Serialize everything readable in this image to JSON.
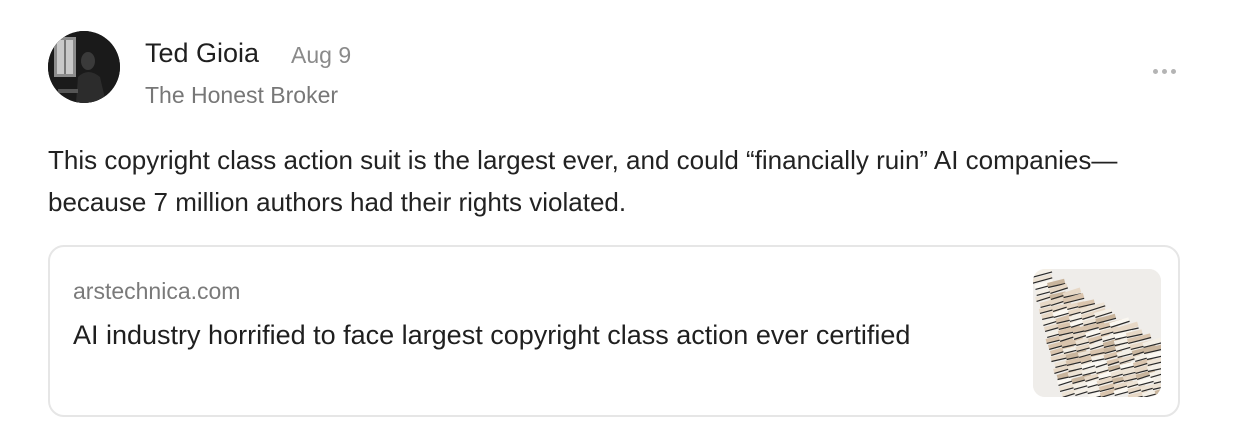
{
  "post": {
    "author": "Ted Gioia",
    "date": "Aug 9",
    "publication": "The Honest Broker",
    "body": "This copyright class action suit is the largest ever, and could “financially ruin” AI companies—because 7 million authors had their rights violated.",
    "avatar_icon": "author-photo",
    "more_icon": "ellipsis-icon"
  },
  "link_card": {
    "domain": "arstechnica.com",
    "title": "AI industry horrified to face largest copyright class action ever certified",
    "thumbnail_icon": "book-stacks-photo"
  },
  "colors": {
    "text_primary": "#1f1f1f",
    "text_secondary": "#777777",
    "card_border": "#e6e6e6"
  }
}
